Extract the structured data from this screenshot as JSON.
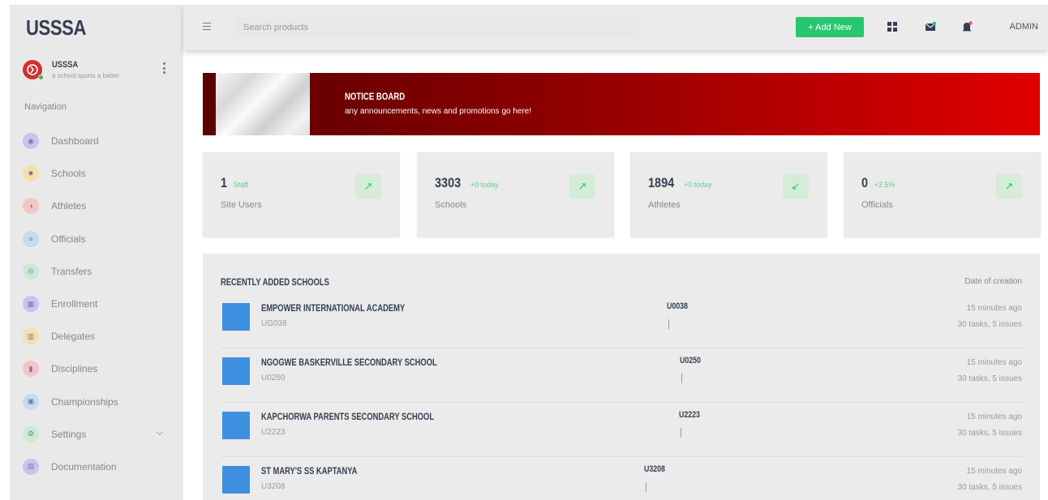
{
  "sidebar": {
    "brand": "USSSA",
    "profile": {
      "name": "USSSA",
      "tagline": "a school sports a better"
    },
    "nav_heading": "Navigation",
    "items": [
      {
        "label": "Dashboard",
        "icon": "dashboard-icon",
        "color": "#c7c3f2",
        "glyph": "◉"
      },
      {
        "label": "Schools",
        "icon": "schools-icon",
        "color": "#f5deaa",
        "glyph": "✸"
      },
      {
        "label": "Athletes",
        "icon": "athletes-icon",
        "color": "#f5c4c4",
        "glyph": "◑"
      },
      {
        "label": "Officials",
        "icon": "officials-icon",
        "color": "#c4dbf2",
        "glyph": "≡"
      },
      {
        "label": "Transfers",
        "icon": "transfers-icon",
        "color": "#c9ecd1",
        "glyph": "◎"
      },
      {
        "label": "Enrollment",
        "icon": "enrollment-icon",
        "color": "#c7c3f2",
        "glyph": "▦"
      },
      {
        "label": "Delegates",
        "icon": "delegates-icon",
        "color": "#f5deaa",
        "glyph": "▥"
      },
      {
        "label": "Disciplines",
        "icon": "disciplines-icon",
        "color": "#f5c4c4",
        "glyph": "▮"
      },
      {
        "label": "Championships",
        "icon": "championships-icon",
        "color": "#c4dbf2",
        "glyph": "▣"
      },
      {
        "label": "Settings",
        "icon": "settings-icon",
        "color": "#c9ecd1",
        "glyph": "⚙"
      },
      {
        "label": "Documentation",
        "icon": "documentation-icon",
        "color": "#c7c3f2",
        "glyph": "▤"
      }
    ]
  },
  "topbar": {
    "search_placeholder": "Search products",
    "add_label": "+ Add New",
    "user_label": "ADMIN"
  },
  "notice": {
    "title": "NOTICE BOARD",
    "subtitle": "any announcements, news and promotions go here!"
  },
  "stats": [
    {
      "value": "1",
      "note": "Staff",
      "label": "Site Users",
      "arrow": "up"
    },
    {
      "value": "3303",
      "note": "+0 today",
      "label": "Schools",
      "arrow": "up"
    },
    {
      "value": "1894",
      "note": "+0 today",
      "label": "Athletes",
      "arrow": "down"
    },
    {
      "value": "0",
      "note": "+3.5%",
      "label": "Officials",
      "arrow": "up"
    }
  ],
  "recent": {
    "title": "RECENTLY ADDED SCHOOLS",
    "column_label": "Date of creation",
    "rows": [
      {
        "name": "EMPOWER INTERNATIONAL ACADEMY",
        "code": "UG038",
        "center": "U0038",
        "time": "15 minutes ago",
        "tasks": "30 tasks, 5 issues"
      },
      {
        "name": "NGOGWE BASKERVILLE SECONDARY SCHOOL",
        "code": "U0250",
        "center": "U0250",
        "time": "15 minutes ago",
        "tasks": "30 tasks, 5 issues"
      },
      {
        "name": "KAPCHORWA PARENTS SECONDARY SCHOOL",
        "code": "U2223",
        "center": "U2223",
        "time": "15 minutes ago",
        "tasks": "30 tasks, 5 issues"
      },
      {
        "name": "ST MARY'S SS KAPTANYA",
        "code": "U3208",
        "center": "U3208",
        "time": "15 minutes ago",
        "tasks": "30 tasks, 5 issues"
      }
    ]
  },
  "colors": {
    "accent_green": "#28c76f",
    "notice_dark": "#5a0000",
    "notice_bright": "#e00000",
    "school_thumb": "#3f8fe0"
  }
}
